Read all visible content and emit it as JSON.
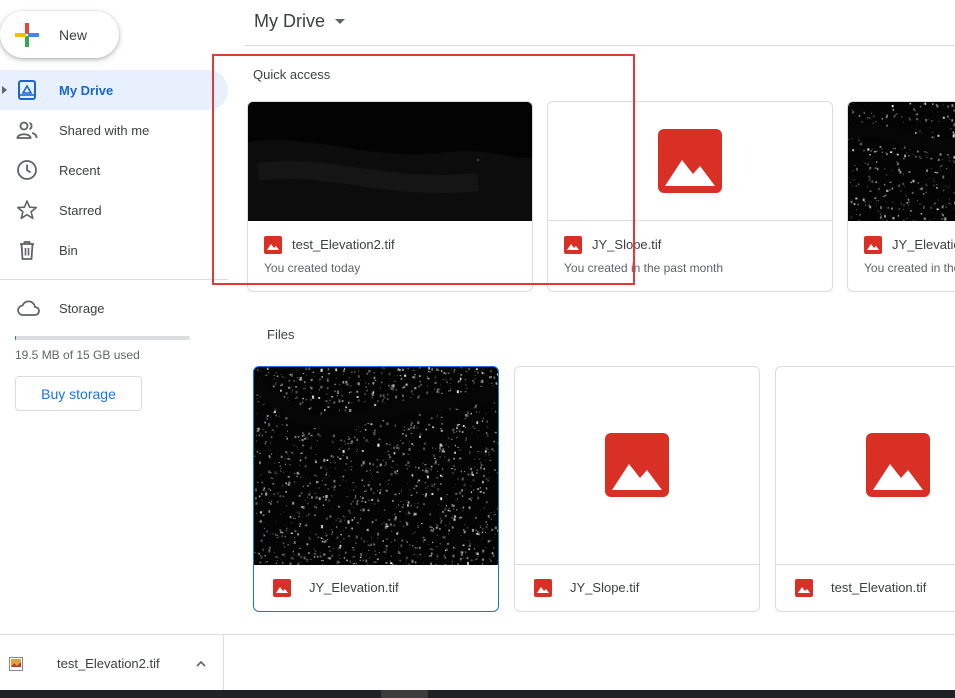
{
  "sidebar": {
    "new_label": "New",
    "items": [
      {
        "label": "My Drive",
        "icon": "my-drive-icon"
      },
      {
        "label": "Shared with me",
        "icon": "people-icon"
      },
      {
        "label": "Recent",
        "icon": "clock-icon"
      },
      {
        "label": "Starred",
        "icon": "star-icon"
      },
      {
        "label": "Bin",
        "icon": "trash-icon"
      }
    ],
    "storage_label": "Storage",
    "storage_used_text": "19.5 MB of 15 GB used",
    "storage_used_fraction": 0.0013,
    "buy_storage_label": "Buy storage"
  },
  "header": {
    "title": "My Drive"
  },
  "quick_access": {
    "heading": "Quick access",
    "cards": [
      {
        "name": "test_Elevation2.tif",
        "subtitle": "You created today",
        "thumbnail": "dark-image"
      },
      {
        "name": "JY_Slope.tif",
        "subtitle": "You created in the past month",
        "thumbnail": "image-icon"
      },
      {
        "name": "JY_Elevation.tif",
        "subtitle": "You created in the past month",
        "thumbnail": "dark-image"
      }
    ]
  },
  "files": {
    "heading": "Files",
    "items": [
      {
        "name": "JY_Elevation.tif",
        "thumbnail": "dark-image",
        "selected": true
      },
      {
        "name": "JY_Slope.tif",
        "thumbnail": "image-icon",
        "selected": false
      },
      {
        "name": "test_Elevation.tif",
        "thumbnail": "image-icon",
        "selected": false
      }
    ]
  },
  "download_bar": {
    "file_name": "test_Elevation2.tif"
  },
  "colors": {
    "accent": "#1a73e8",
    "active_nav_bg": "#e8f0fe",
    "image_icon_red": "#d93025",
    "highlight_box": "#e53935"
  }
}
